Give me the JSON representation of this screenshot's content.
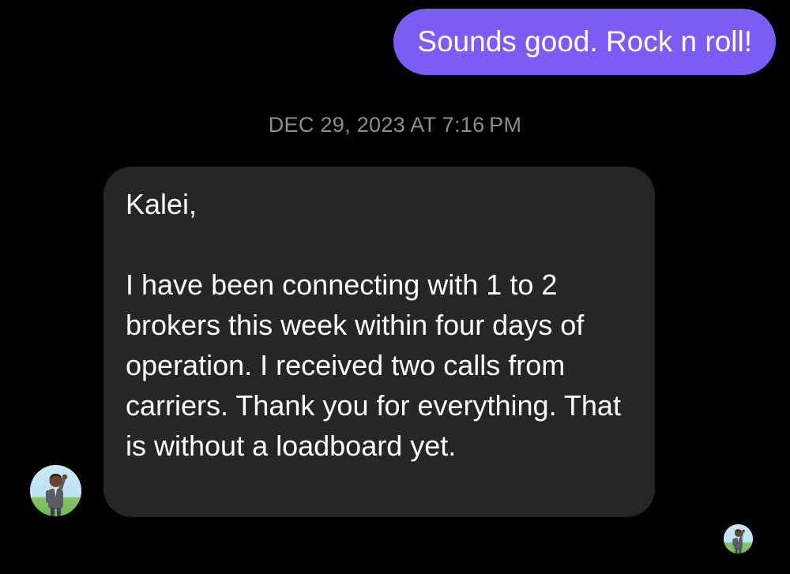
{
  "conversation": {
    "sent_message": {
      "text": "Sounds good. Rock n roll!"
    },
    "timestamp": "DEC 29, 2023 AT 7:16 PM",
    "received_message": {
      "greeting": "Kalei,",
      "body": "I have been connecting with 1 to 2 brokers this week within four days of operation. I received two calls from carriers. Thank you for everything. That is without a loadboard yet."
    },
    "sender_avatar": {
      "icon": "memoji-avatar-icon"
    },
    "read_receipt_avatar": {
      "icon": "memoji-avatar-icon"
    }
  },
  "colors": {
    "background": "#000000",
    "sent_bubble": "#7b5cf5",
    "received_bubble": "#262628",
    "timestamp_text": "#8c8c92"
  }
}
